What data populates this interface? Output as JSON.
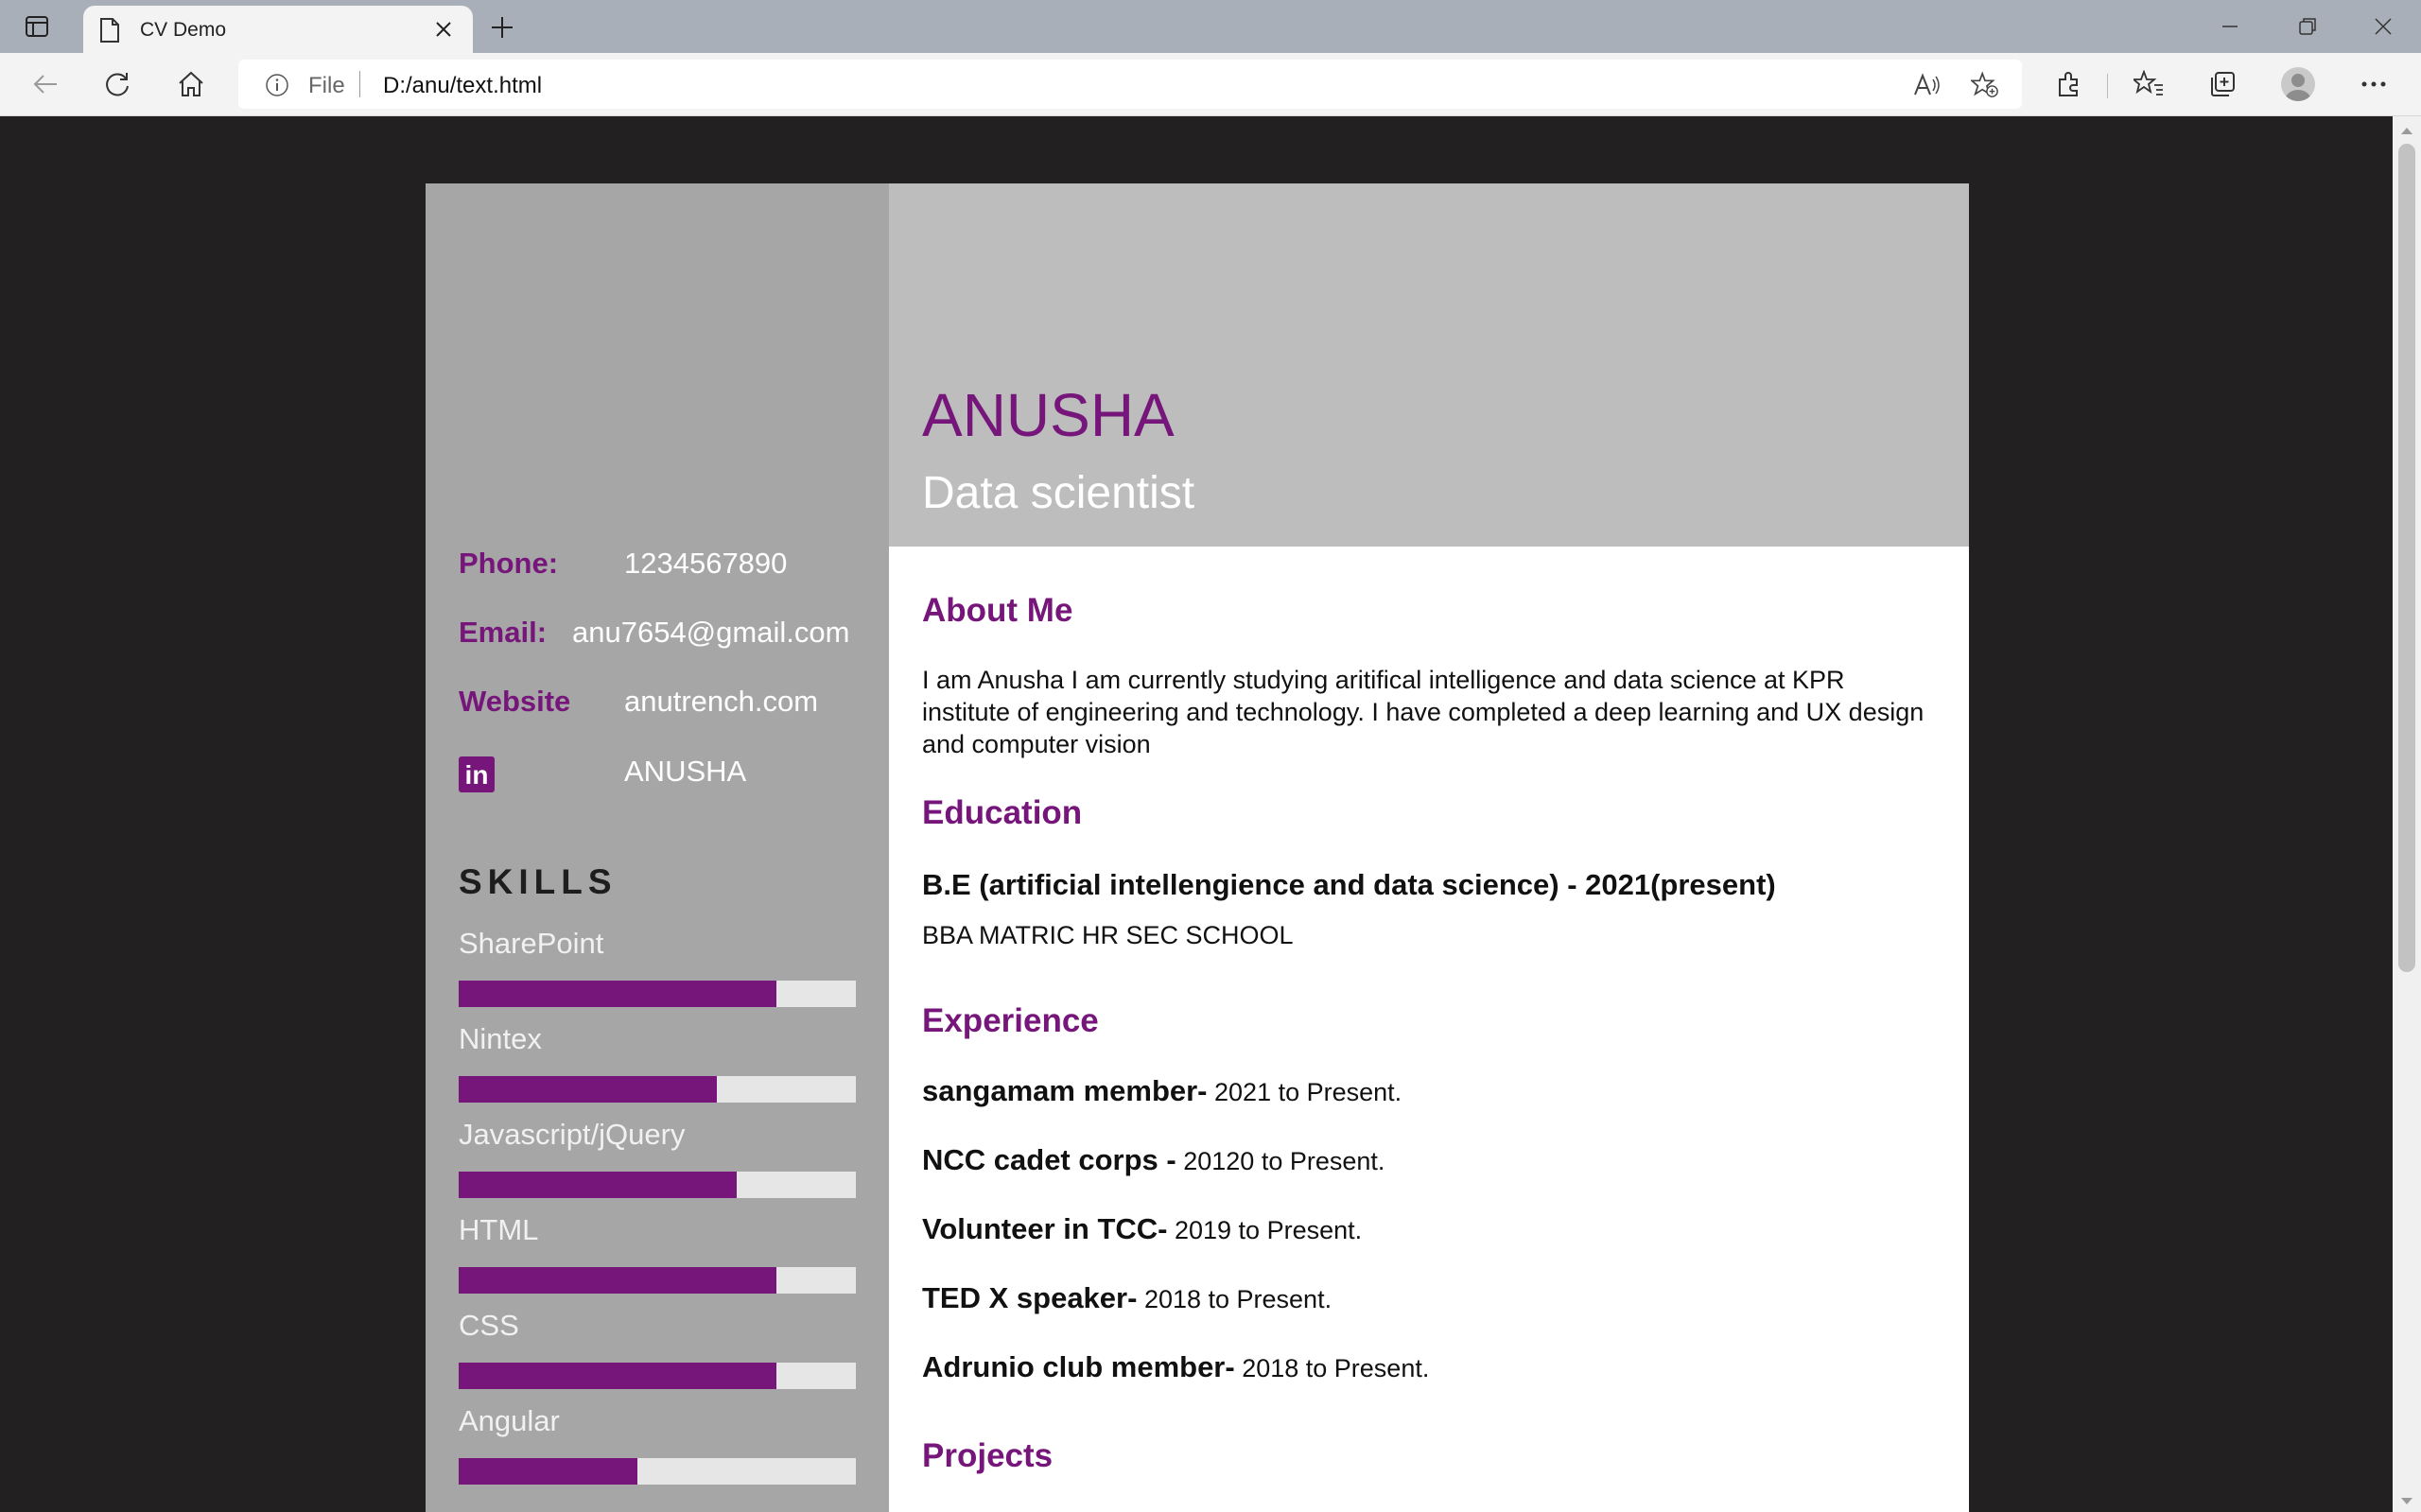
{
  "browser": {
    "tab_title": "CV Demo",
    "address_scheme": "File",
    "address_url": "D:/anu/text.html"
  },
  "cv": {
    "name": "ANUSHA",
    "role": "Data scientist",
    "contact": {
      "phone_label": "Phone:",
      "phone": "1234567890",
      "email_label": "Email:",
      "email": "anu7654@gmail.com",
      "website_label": "Website",
      "website": "anutrench.com",
      "linkedin_icon_text": "in",
      "linkedin": "ANUSHA"
    },
    "skills_title": "SKILLS",
    "skills": [
      {
        "name": "SharePoint",
        "level": 0.8
      },
      {
        "name": "Nintex",
        "level": 0.65
      },
      {
        "name": "Javascript/jQuery",
        "level": 0.7
      },
      {
        "name": "HTML",
        "level": 0.8
      },
      {
        "name": "CSS",
        "level": 0.8
      },
      {
        "name": "Angular",
        "level": 0.45
      }
    ],
    "about_title": "About Me",
    "about_text": "I am Anusha I am currently studying aritifical intelligence and data science at KPR institute of engineering and technology. I have completed a deep learning and UX design and computer vision",
    "education_title": "Education",
    "education_degree": "B.E (artificial intellengience and data science) - 2021(present)",
    "education_school": "BBA MATRIC HR SEC SCHOOL",
    "experience_title": "Experience",
    "experience": [
      {
        "role": "sangamam member-",
        "period": " 2021 to Present."
      },
      {
        "role": "NCC cadet corps -",
        "period": " 20120 to Present."
      },
      {
        "role": "Volunteer in TCC-",
        "period": " 2019 to Present."
      },
      {
        "role": "TED X speaker-",
        "period": " 2018 to Present."
      },
      {
        "role": "Adrunio club member-",
        "period": " 2018 to Present."
      }
    ],
    "projects_title": "Projects"
  },
  "colors": {
    "accent": "#76157a",
    "sidebar": "#a6a6a6",
    "header": "#bdbdbd",
    "page_bg": "#222021"
  },
  "icons": [
    "tab-actions-icon",
    "page-icon",
    "close-icon",
    "plus-icon",
    "minimize-icon",
    "restore-icon",
    "window-close-icon",
    "back-icon",
    "refresh-icon",
    "home-icon",
    "info-icon",
    "read-aloud-icon",
    "add-favorite-icon",
    "extensions-icon",
    "favorites-icon",
    "collections-icon",
    "profile-icon",
    "more-icon",
    "linkedin-icon"
  ]
}
